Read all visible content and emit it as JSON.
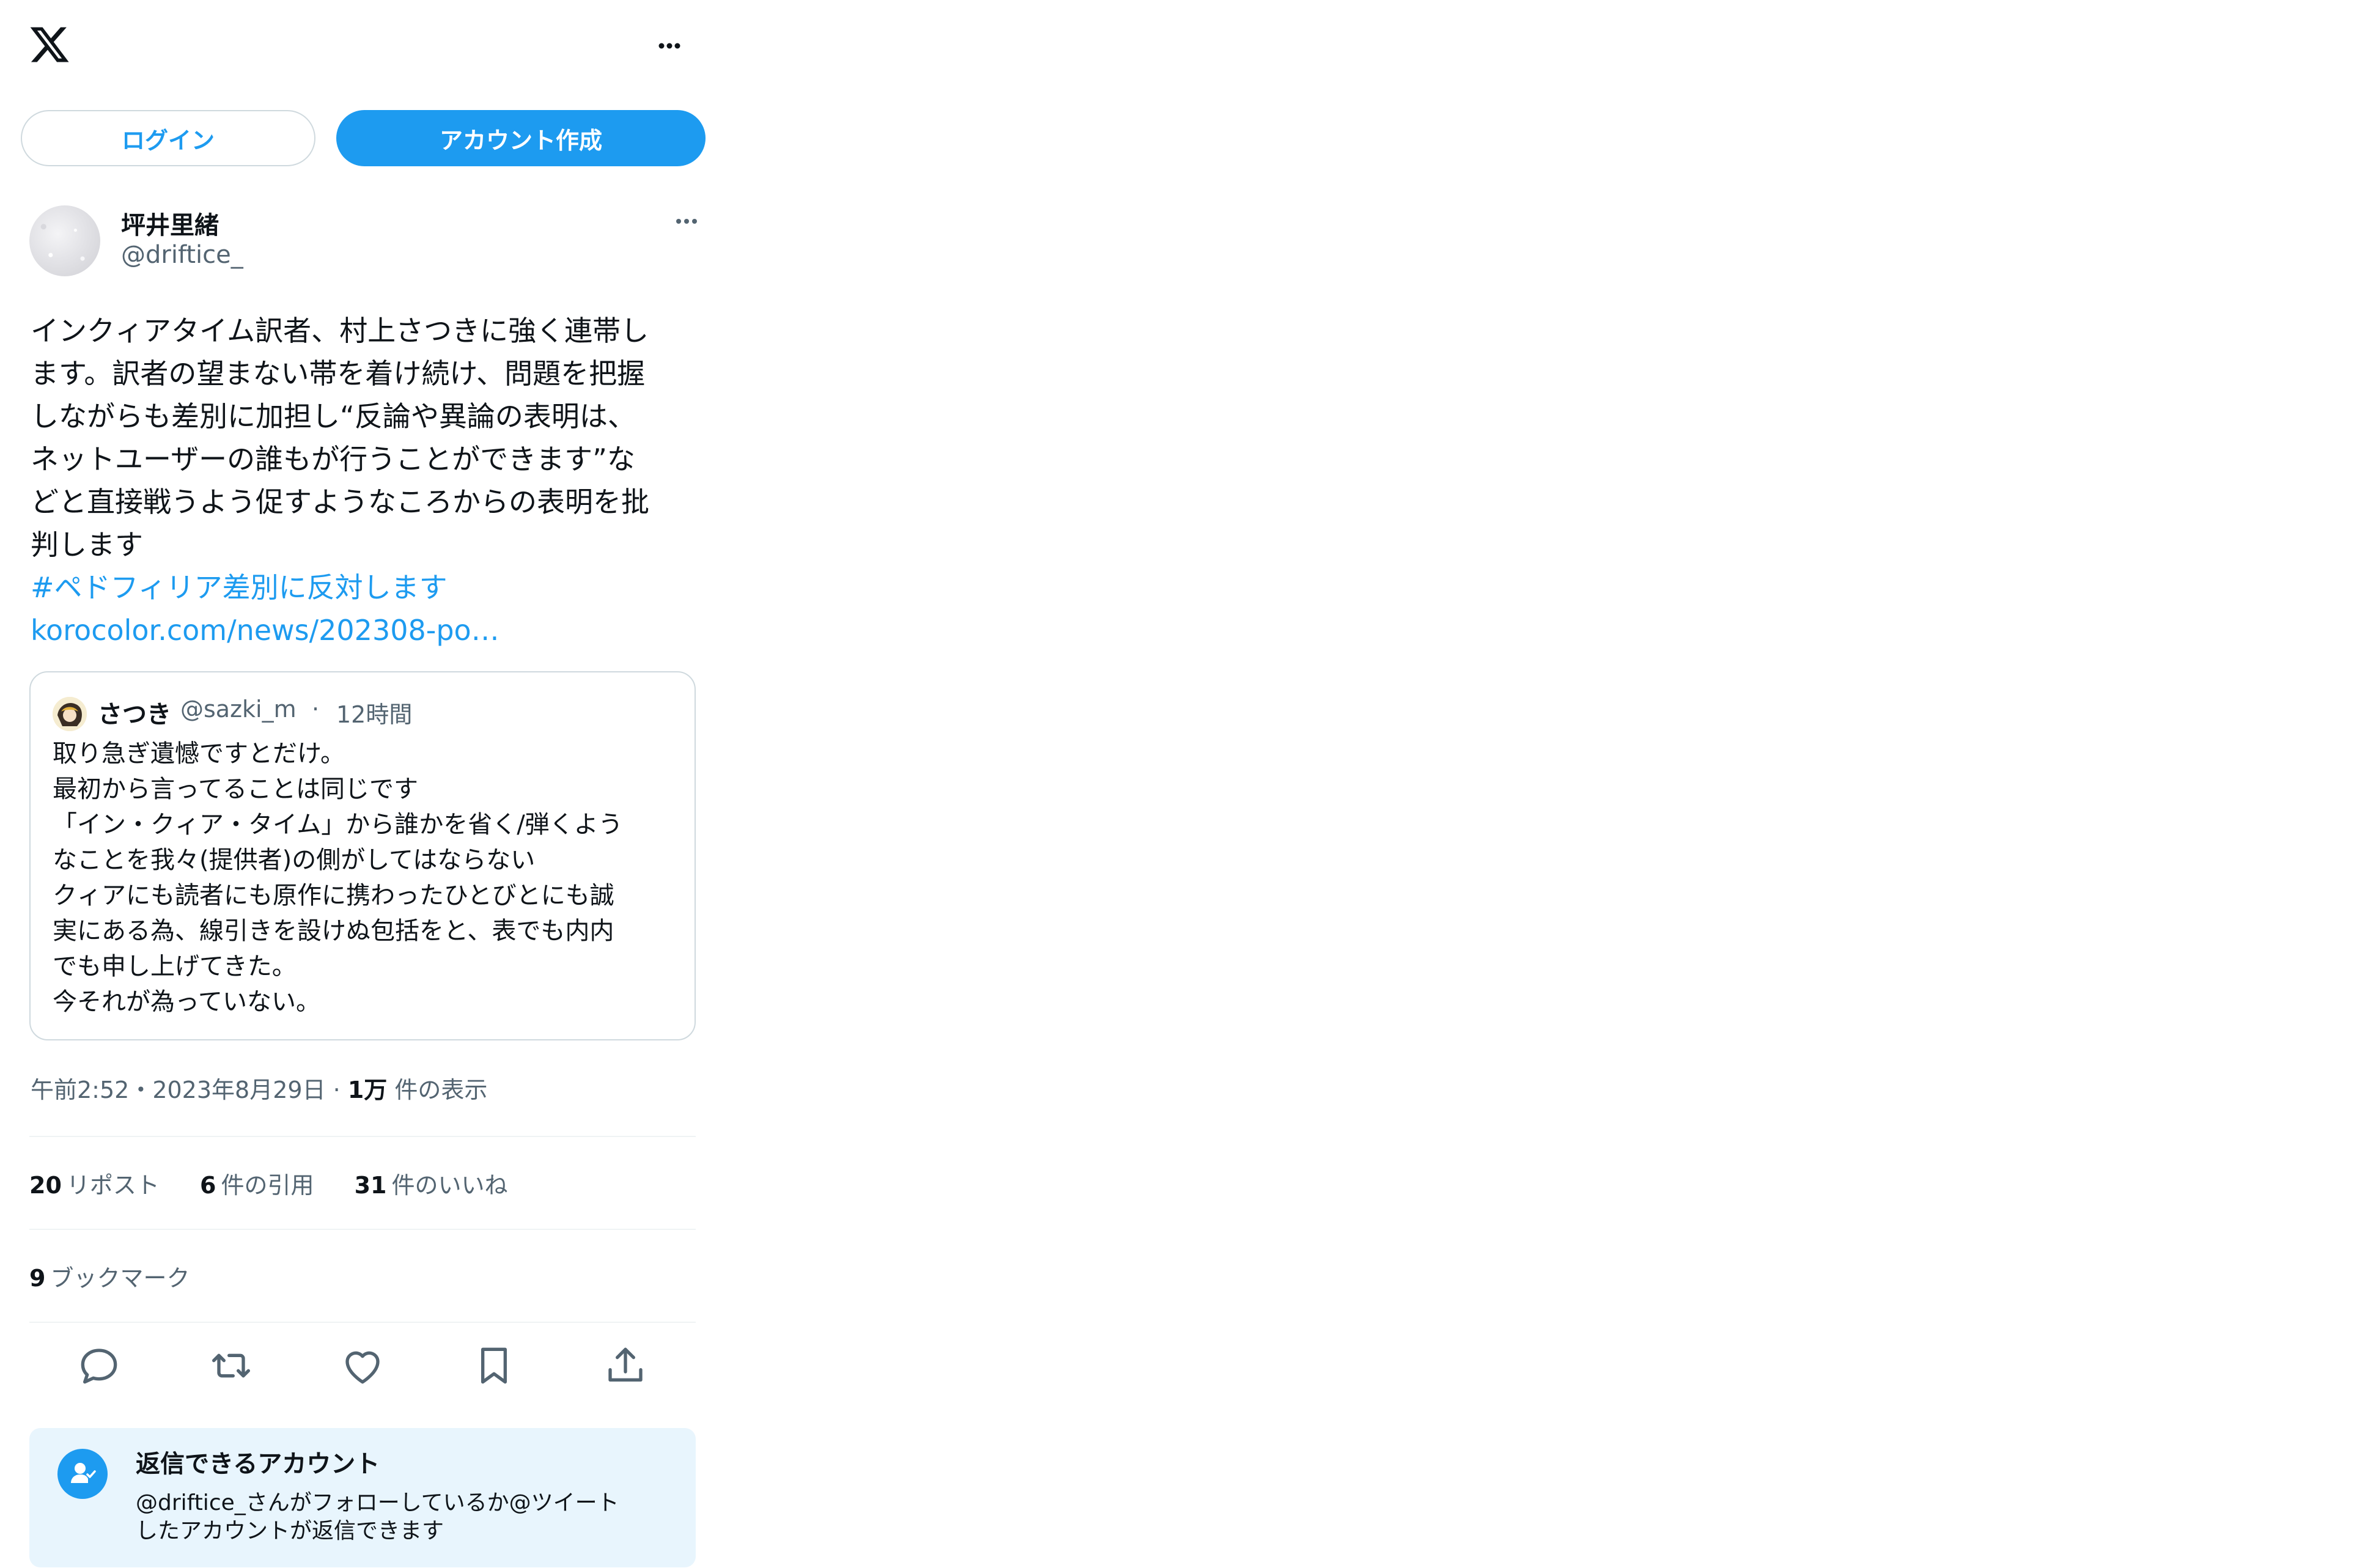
{
  "header": {
    "logo_icon": "x-logo-icon",
    "more_icon": "more-horizontal-icon"
  },
  "auth": {
    "login_label": "ログイン",
    "signup_label": "アカウント作成"
  },
  "post": {
    "author_name": "坪井里緒",
    "author_handle": "@driftice_",
    "body_lines": [
      "インクィアタイム訳者、村上さつきに強く連帯し",
      "ます。訳者の望まない帯を着け続け、問題を把握",
      "しながらも差別に加担し“反論や異論の表明は、",
      "ネットユーザーの誰もが行うことができます”な",
      "どと直接戦うよう促すようなころからの表明を批",
      "判します"
    ],
    "hashtag": "#ペドフィリア差別に反対します",
    "link": "korocolor.com/news/202308-po…",
    "timestamp": "午前2:52・2023年8月29日",
    "views_count": "1万",
    "views_label": "件の表示"
  },
  "quote": {
    "author_name": "さつき",
    "author_handle": "@sazki_m",
    "separator": "·",
    "time": "12時間",
    "body_lines": [
      "取り急ぎ遺憾ですとだけ。",
      "最初から言ってることは同じです",
      "「イン・クィア・タイム」から誰かを省く/弾くよう",
      "なことを我々(提供者)の側がしてはならない",
      "クィアにも読者にも原作に携わったひとびとにも誠",
      "実にある為、線引きを設けぬ包括をと、表でも内内",
      "でも申し上げてきた。",
      "今それが為っていない。"
    ]
  },
  "stats": {
    "reposts_count": "20",
    "reposts_label": "リポスト",
    "quotes_count": "6",
    "quotes_label": "件の引用",
    "likes_count": "31",
    "likes_label": "件のいいね",
    "bookmarks_count": "9",
    "bookmarks_label": "ブックマーク"
  },
  "actions": {
    "icons": [
      "reply-icon",
      "repost-icon",
      "like-icon",
      "bookmark-icon",
      "share-icon"
    ]
  },
  "reply_settings": {
    "title": "返信できるアカウント",
    "desc_lines": [
      "@driftice_さんがフォローしているか@ツイート",
      "したアカウントが返信できます"
    ]
  },
  "colors": {
    "accent": "#1d9bf0",
    "text_primary": "#0f1419",
    "text_secondary": "#536471",
    "border": "#cfd9de",
    "reply_bg": "#e8f5fd"
  }
}
